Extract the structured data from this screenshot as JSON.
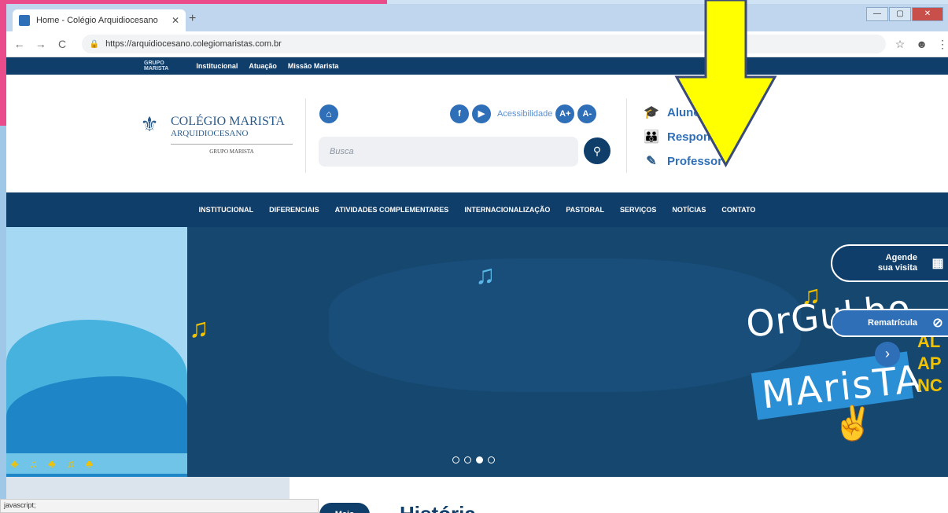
{
  "browser": {
    "tab_title": "Home - Colégio Arquidiocesano",
    "tab_close": "✕",
    "new_tab": "+",
    "url": "https://arquidiocesano.colegiomaristas.com.br",
    "nav_back": "←",
    "nav_forward": "→",
    "nav_reload": "C",
    "lock": "🔒",
    "star": "☆",
    "account": "☻",
    "menu": "⋮",
    "window_controls": {
      "minimize": "—",
      "maximize": "▢",
      "close": "✕"
    },
    "status_text": "javascript;"
  },
  "topbar": {
    "logo_line1": "GRUPO",
    "logo_line2": "MARISTA",
    "links": [
      "Institucional",
      "Atuação",
      "Missão Marista"
    ]
  },
  "header": {
    "logo_mark": "⚜",
    "logo_main": "COLÉGIO MARISTA",
    "logo_sub": "ARQUIDIOCESANO",
    "logo_group": "GRUPO MARISTA",
    "home_icon": "⌂",
    "social": {
      "facebook": "f",
      "youtube": "▶"
    },
    "accessibility_label": "Acessibilidade",
    "font_increase": "A+",
    "font_decrease": "A-",
    "search_placeholder": "Busca",
    "search_icon": "⚲",
    "portals": [
      {
        "icon": "🎓",
        "label": "Aluno"
      },
      {
        "icon": "👪",
        "label": "Responsável"
      },
      {
        "icon": "✎",
        "label": "Professor"
      }
    ]
  },
  "main_nav": [
    "INSTITUCIONAL",
    "DIFERENCIAIS",
    "ATIVIDADES COMPLEMENTARES",
    "INTERNACIONALIZAÇÃO",
    "PASTORAL",
    "SERVIÇOS",
    "NOTÍCIAS",
    "CONTATO"
  ],
  "hero": {
    "headline_line1": "OrGuLho",
    "headline_line2": "MArisTA",
    "note_icon": "♫",
    "peace_icon": "✌",
    "next_icon": "›",
    "side_text": [
      "AL",
      "AP",
      "NC"
    ],
    "strip_icons": "♣ ♫ ♣ ♫ ♣",
    "slide_count": 4,
    "active_slide": 3,
    "badge_schedule_line1": "Agende",
    "badge_schedule_line2": "sua visita",
    "badge_schedule_icon": "▦",
    "badge_reenroll": "Rematrícula",
    "badge_reenroll_icon": "⊘"
  },
  "section": {
    "more_button": "Mais",
    "title": "História"
  },
  "colors": {
    "navy": "#0f3e6b",
    "blue": "#2f6fb8",
    "pink": "#e94b8b",
    "yellow": "#f2c200",
    "arrow": "#ffff00"
  }
}
